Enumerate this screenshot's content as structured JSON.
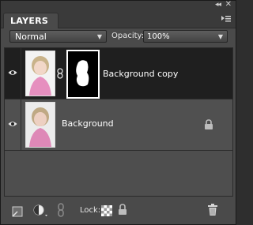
{
  "panel": {
    "tab_label": "LAYERS",
    "collapse_glyph": "◂◂",
    "close_glyph": "✕",
    "menu_icon": "panel-menu-icon"
  },
  "options": {
    "blend_mode": "Normal",
    "opacity_label": "Opacity:",
    "opacity_value": "100%"
  },
  "layers": [
    {
      "name": "Background copy",
      "selected": true,
      "visible": true,
      "has_mask": true,
      "locked": false
    },
    {
      "name": "Background",
      "selected": false,
      "visible": true,
      "has_mask": false,
      "locked": true
    }
  ],
  "footer": {
    "lock_label": "Lock:"
  },
  "colors": {
    "panel_bg": "#4a4a4a",
    "selected_row": "#1f1f1f",
    "text": "#ffffff"
  }
}
